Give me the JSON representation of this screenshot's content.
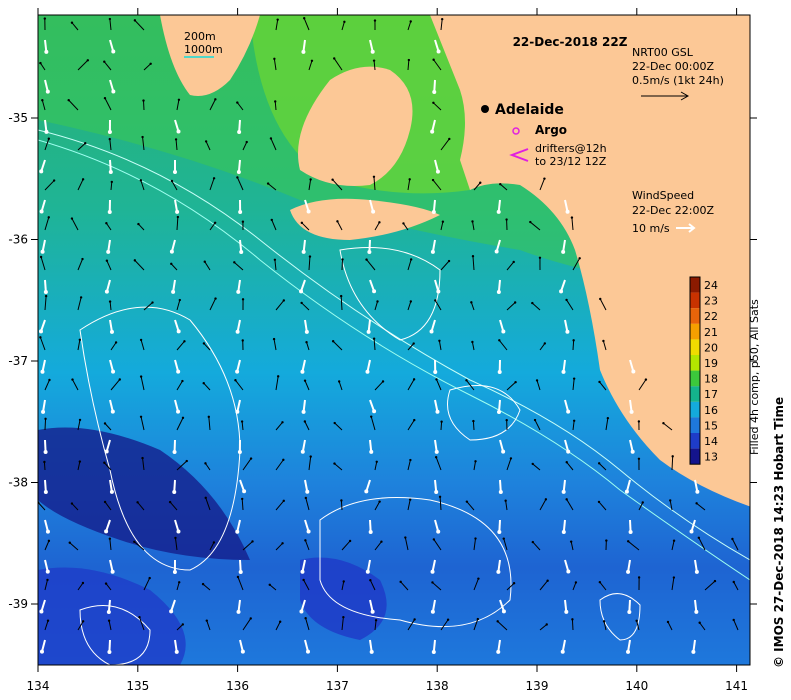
{
  "title": "22-Dec-2018 22Z",
  "legend_depth": {
    "line1": "200m",
    "line2": "1000m"
  },
  "currents_legend": {
    "source": "NRT00 GSL",
    "time": "22-Dec 00:00Z",
    "scale": "0.5m/s (1kt 24h)"
  },
  "city": {
    "name": "Adelaide"
  },
  "argo": {
    "label": "Argo"
  },
  "drifters": {
    "line1": "drifters@12h",
    "line2": "to 23/12 12Z"
  },
  "wind_legend": {
    "title": "WindSpeed",
    "time": "22-Dec 22:00Z",
    "scale": "10 m/s"
  },
  "colorbar": {
    "label": "Filled 4h comp, p50, All Sats",
    "ticks": [
      "24",
      "23",
      "22",
      "21",
      "20",
      "19",
      "18",
      "17",
      "16",
      "15",
      "14",
      "13"
    ],
    "colors": [
      "#8b1a00",
      "#c83200",
      "#e8640a",
      "#f5a000",
      "#f0dc00",
      "#b4e600",
      "#3cc83c",
      "#14b48c",
      "#14aadc",
      "#1e78dc",
      "#1e3cc8",
      "#14148c"
    ]
  },
  "credit": "© IMOS 27-Dec-2018 14:23 Hobart Time",
  "axes": {
    "x_ticks": [
      "134",
      "135",
      "136",
      "137",
      "138",
      "139",
      "140",
      "141"
    ],
    "y_ticks": [
      "-35",
      "-36",
      "-37",
      "-38",
      "-39"
    ]
  },
  "colors": {
    "land": "#fcc896",
    "arrow_current": "#000000",
    "arrow_wind": "#ffffff",
    "argo": "#e020e0",
    "drifter": "#e020e0"
  }
}
